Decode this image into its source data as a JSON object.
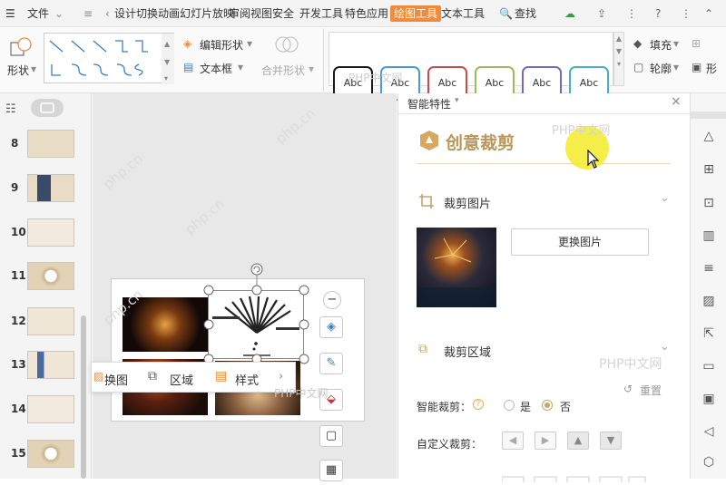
{
  "menubar": {
    "file": "文件",
    "tabs": [
      "设计",
      "切换",
      "动画",
      "幻灯片放映",
      "审阅",
      "视图",
      "安全",
      "开发工具",
      "特色应用",
      "绘图工具",
      "文本工具"
    ],
    "active_tab": "绘图工具",
    "search": "查找"
  },
  "ribbon": {
    "shape": "形状",
    "edit_shape": "编辑形状",
    "textbox": "文本框",
    "merge_shape": "合并形状",
    "style_sample": "Abc",
    "style_colors": [
      "#1a1a1a",
      "#4b9ad8",
      "#c94c4c",
      "#9bbb59",
      "#7b68b5",
      "#4bacc6"
    ],
    "fill": "填充",
    "outline": "轮廓",
    "shape_effect": "形"
  },
  "thumbnails": {
    "numbers": [
      "8",
      "9",
      "10",
      "11",
      "12",
      "13",
      "14",
      "15"
    ]
  },
  "canvas": {
    "context_menu": [
      "换图",
      "区域",
      "样式"
    ]
  },
  "pane": {
    "header": "智能特性",
    "title": "创意裁剪",
    "section_crop_image": "裁剪图片",
    "replace_button": "更换图片",
    "section_crop_area": "裁剪区域",
    "reset": "重置",
    "smart_crop_label": "智能裁剪：",
    "smart_crop_yes": "是",
    "smart_crop_no": "否",
    "smart_crop_selected": "否",
    "custom_crop_label": "自定义裁剪："
  },
  "watermark": "PHP中文网",
  "watermark_site": "php.cn",
  "accent_color": "#f08a3c"
}
